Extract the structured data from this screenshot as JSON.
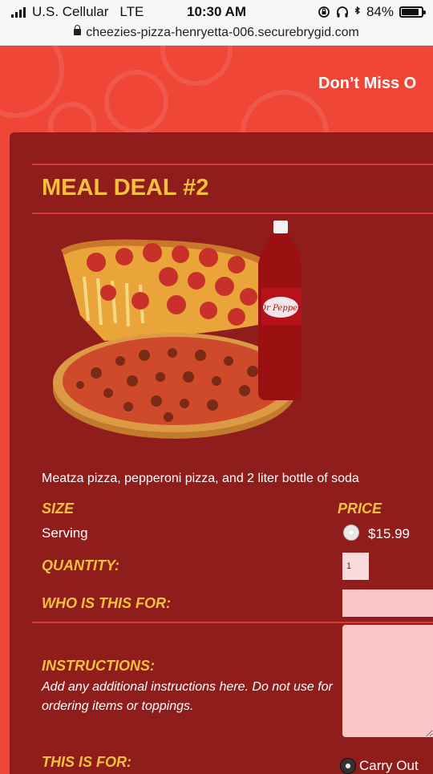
{
  "status_bar": {
    "carrier": "U.S. Cellular",
    "network": "LTE",
    "time": "10:30 AM",
    "battery": "84%"
  },
  "browser": {
    "url": "cheezies-pizza-henryetta-006.securebrygid.com"
  },
  "banner": {
    "text": "Don’t Miss O"
  },
  "deal": {
    "title": "MEAL DEAL #2",
    "bottle_label": "Dr Pepper",
    "description": "Meatza pizza, pepperoni pizza, and 2 liter bottle of soda"
  },
  "form": {
    "size_label": "SIZE",
    "price_label": "PRICE",
    "size_value": "Serving",
    "price_value": "$15.99",
    "quantity_label": "QUANTITY:",
    "quantity_value": "1",
    "who_label": "WHO IS THIS FOR:",
    "who_value": "",
    "instructions_label": "INSTRUCTIONS:",
    "instructions_help": "Add any additional instructions here. Do not use for ordering items or toppings.",
    "this_is_for_label": "THIS IS FOR:",
    "carry_out_label": "Carry Out"
  },
  "colors": {
    "background": "#f04638",
    "card": "#8e1d1c",
    "accent_text": "#f6c13a",
    "input": "#fcc6c6"
  }
}
